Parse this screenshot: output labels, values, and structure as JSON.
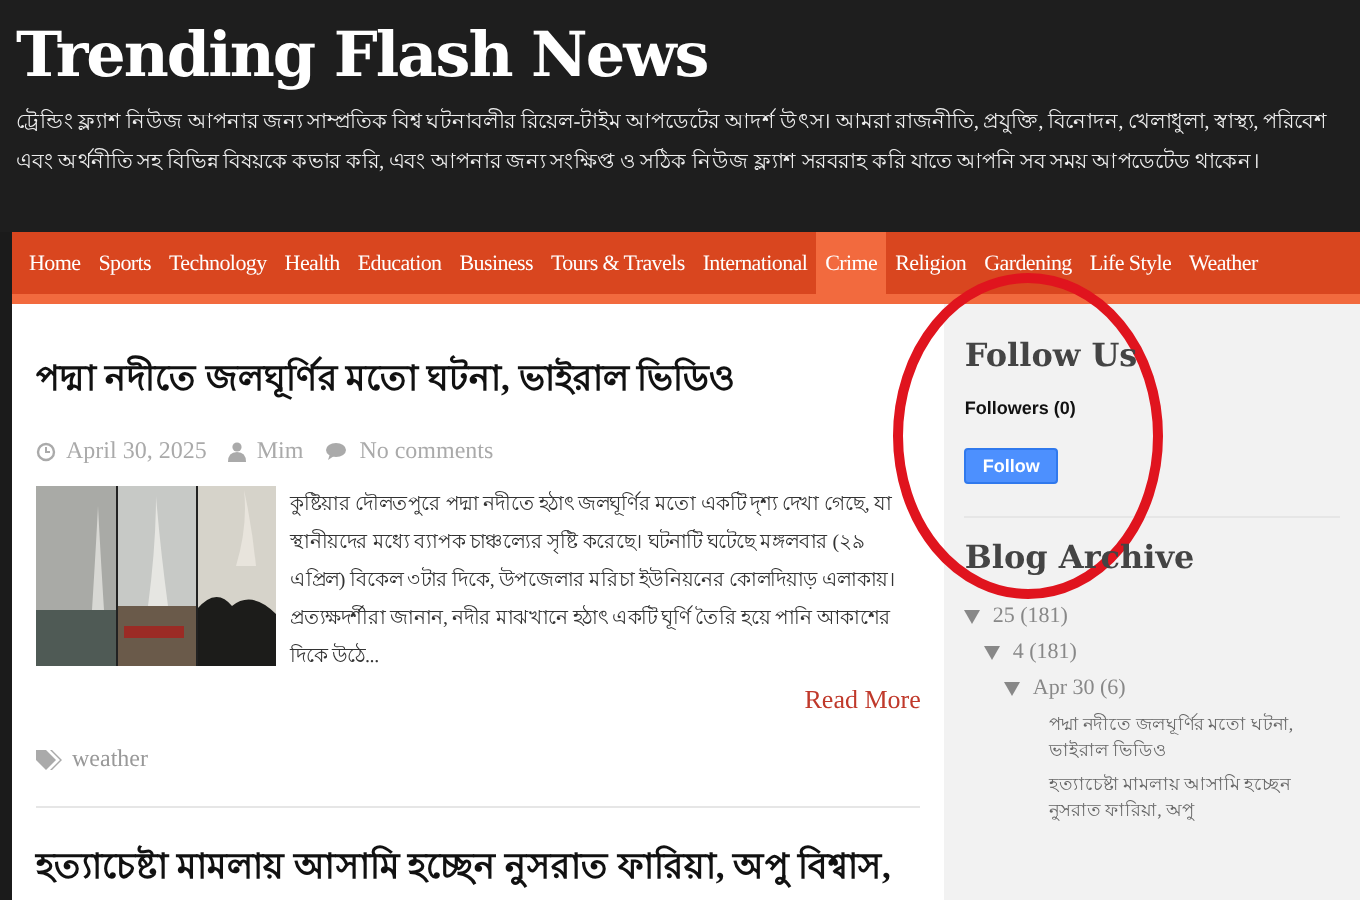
{
  "site": {
    "title": "Trending Flash News",
    "description": "ট্রেন্ডিং ফ্ল্যাশ নিউজ আপনার জন্য সাম্প্রতিক বিশ্ব ঘটনাবলীর রিয়েল-টাইম আপডেটের আদর্শ উৎস। আমরা রাজনীতি, প্রযুক্তি, বিনোদন, খেলাধুলা, স্বাস্থ্য, পরিবেশ এবং অর্থনীতি সহ বিভিন্ন বিষয়কে কভার করি, এবং আপনার জন্য সংক্ষিপ্ত ও সঠিক নিউজ ফ্ল্যাশ সরবরাহ করি যাতে আপনি সব সময় আপডেটেড থাকেন।"
  },
  "nav": [
    {
      "label": "Home",
      "selected": false
    },
    {
      "label": "Sports",
      "selected": false
    },
    {
      "label": "Technology",
      "selected": false
    },
    {
      "label": "Health",
      "selected": false
    },
    {
      "label": "Education",
      "selected": false
    },
    {
      "label": "Business",
      "selected": false
    },
    {
      "label": "Tours & Travels",
      "selected": false
    },
    {
      "label": "International",
      "selected": false
    },
    {
      "label": "Crime",
      "selected": true
    },
    {
      "label": "Religion",
      "selected": false
    },
    {
      "label": "Gardening",
      "selected": false
    },
    {
      "label": "Life Style",
      "selected": false
    },
    {
      "label": "Weather",
      "selected": false
    }
  ],
  "posts": [
    {
      "title": "পদ্মা নদীতে জলঘূর্ণির মতো ঘটনা, ভাইরাল ভিডিও",
      "date": "April 30, 2025",
      "author": "Mim",
      "comments": "No comments",
      "excerpt": "কুষ্টিয়ার দৌলতপুরে পদ্মা নদীতে হঠাৎ জলঘূর্ণির মতো একটি দৃশ্য দেখা গেছে, যা স্থানীয়দের মধ্যে ব্যাপক চাঞ্চল্যের সৃষ্টি করেছে। ঘটনাটি ঘটেছে মঙ্গলবার (২৯ এপ্রিল) বিকেল ৩টার দিকে, উপজেলার মরিচা ইউনিয়নের কোলদিয়াড় এলাকায়। প্রত্যক্ষদর্শীরা জানান, নদীর মাঝখানে হঠাৎ একটি ঘূর্ণি তৈরি হয়ে পানি আকাশের দিকে উঠে...",
      "read_more": "Read More",
      "tag": "weather"
    },
    {
      "title": "হত্যাচেষ্টা মামলায় আসামি হচ্ছেন নুসরাত ফারিয়া, অপু বিশ্বাস,"
    }
  ],
  "sidebar": {
    "follow": {
      "title": "Follow Us",
      "followers": "Followers (0)",
      "button": "Follow"
    },
    "archive": {
      "title": "Blog Archive",
      "items": [
        {
          "label": "25 (181)",
          "expanded": true,
          "children": [
            {
              "label": "4 (181)",
              "expanded": true,
              "children": [
                {
                  "label": "Apr 30 (6)",
                  "expanded": true,
                  "children": [
                    {
                      "label": "পদ্মা নদীতে জলঘূর্ণির মতো ঘটনা, ভাইরাল ভিডিও"
                    },
                    {
                      "label": "হত্যাচেষ্টা মামলায় আসামি হচ্ছেন নুসরাত ফারিয়া, অপু"
                    }
                  ]
                }
              ]
            }
          ]
        }
      ]
    }
  },
  "annotation": {
    "kind": "circle"
  }
}
